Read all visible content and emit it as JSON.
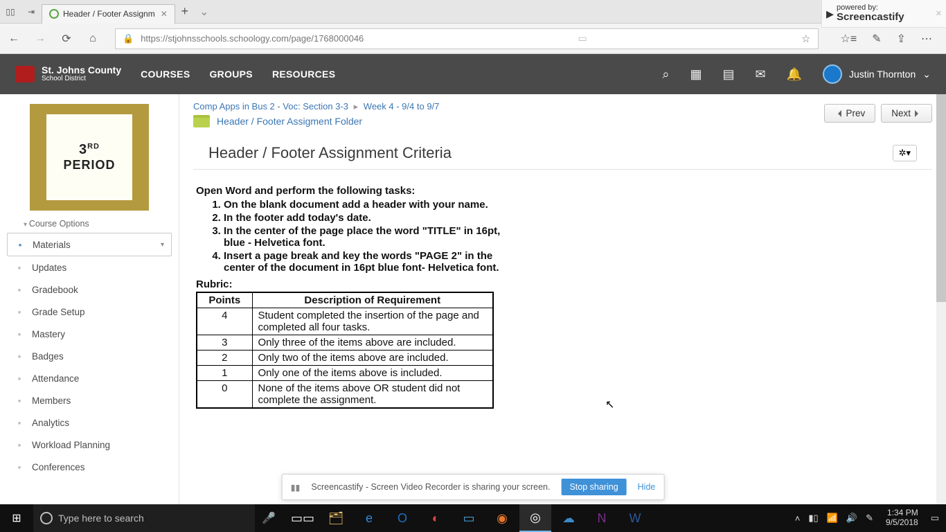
{
  "browser": {
    "tab_title": "Header / Footer Assignm",
    "url": "https://stjohnsschools.schoology.com/page/1768000046"
  },
  "castify": {
    "powered_by": "powered by:",
    "brand": "Screencastify"
  },
  "schoology": {
    "org_line1": "St. Johns County",
    "org_line2": "School District",
    "nav": {
      "courses": "COURSES",
      "groups": "GROUPS",
      "resources": "RESOURCES"
    },
    "user": "Justin Thornton"
  },
  "sidebar": {
    "period_top": "3",
    "period_sup": "RD",
    "period_bottom": "PERIOD",
    "course_options": "Course Options",
    "items": [
      {
        "label": "Materials",
        "active": true
      },
      {
        "label": "Updates"
      },
      {
        "label": "Gradebook"
      },
      {
        "label": "Grade Setup"
      },
      {
        "label": "Mastery"
      },
      {
        "label": "Badges"
      },
      {
        "label": "Attendance"
      },
      {
        "label": "Members"
      },
      {
        "label": "Analytics"
      },
      {
        "label": "Workload Planning"
      },
      {
        "label": "Conferences"
      }
    ]
  },
  "breadcrumb": {
    "a": "Comp Apps in Bus 2 - Voc: Section 3-3",
    "b": "Week 4 - 9/4 to 9/7",
    "folder": "Header / Footer Assigment Folder"
  },
  "nav_buttons": {
    "prev": "Prev",
    "next": "Next"
  },
  "page_title": "Header / Footer Assignment Criteria",
  "content": {
    "intro": "Open Word and perform the following tasks:",
    "steps": [
      "On the blank document add a header with your name.",
      "In the footer add today's date.",
      "In the center of the page place the word \"TITLE\" in 16pt, blue - Helvetica font.",
      "Insert a page break and key the words \"PAGE 2\" in the center of the document in 16pt blue font- Helvetica font."
    ],
    "rubric_label": "Rubric:",
    "rubric_headers": {
      "points": "Points",
      "desc": "Description of Requirement"
    },
    "rubric_rows": [
      {
        "points": "4",
        "desc": "Student completed the insertion of the page and completed all four tasks."
      },
      {
        "points": "3",
        "desc": "Only three of the items above are included."
      },
      {
        "points": "2",
        "desc": "Only two of the items above are included."
      },
      {
        "points": "1",
        "desc": "Only one of the items above is included."
      },
      {
        "points": "0",
        "desc": "None of the items above OR student did not complete the assignment."
      }
    ]
  },
  "share_bar": {
    "msg": "Screencastify - Screen Video Recorder is sharing your screen.",
    "stop": "Stop sharing",
    "hide": "Hide"
  },
  "taskbar": {
    "search_placeholder": "Type here to search",
    "time": "1:34 PM",
    "date": "9/5/2018"
  }
}
